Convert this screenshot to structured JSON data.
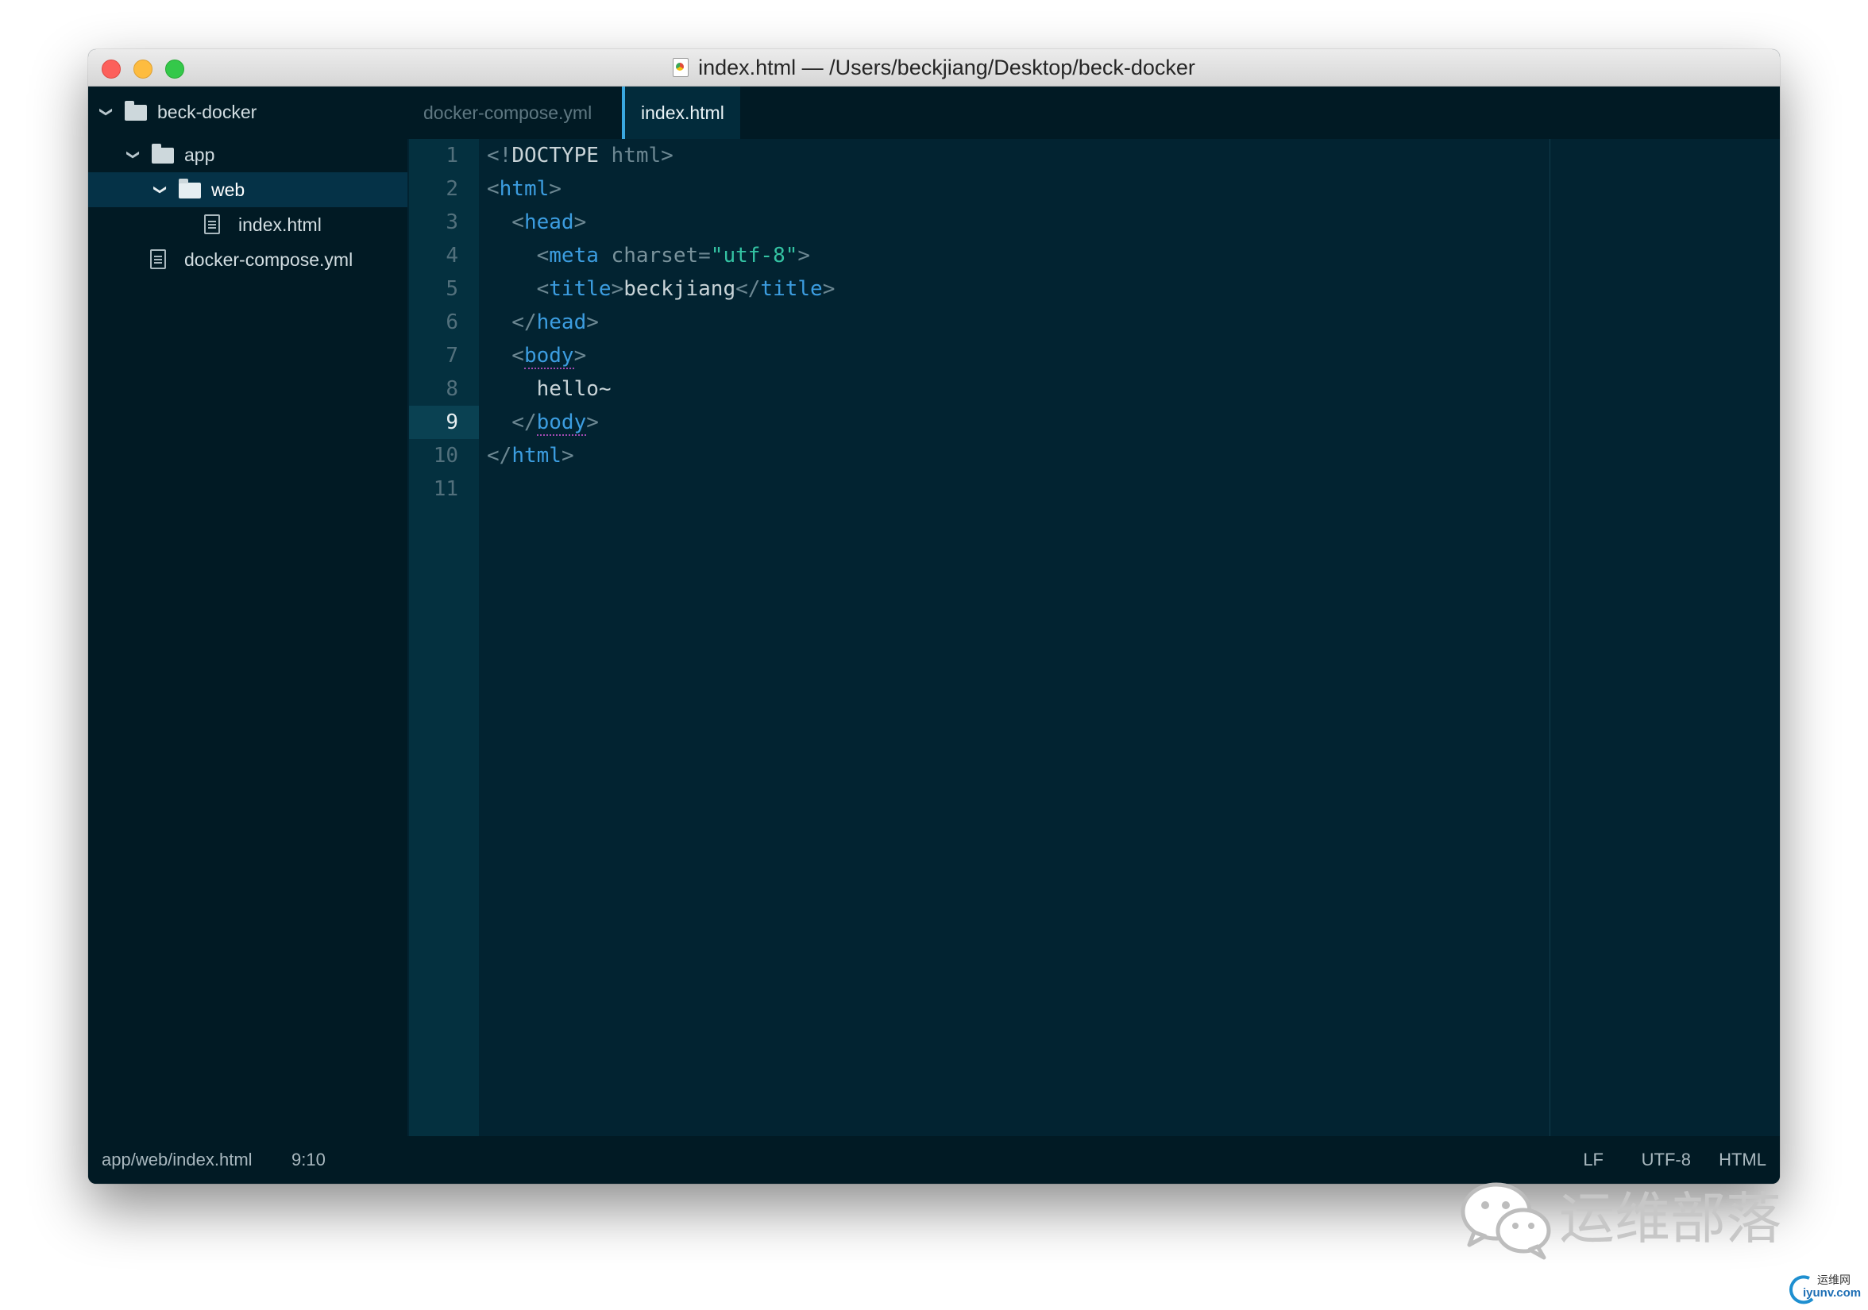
{
  "window": {
    "title": "index.html — /Users/beckjiang/Desktop/beck-docker"
  },
  "sidebar": {
    "project": "beck-docker",
    "items": [
      {
        "label": "app"
      },
      {
        "label": "web"
      },
      {
        "label": "index.html"
      },
      {
        "label": "docker-compose.yml"
      }
    ]
  },
  "tabs": [
    {
      "label": "docker-compose.yml"
    },
    {
      "label": "index.html"
    }
  ],
  "editor": {
    "line_numbers": [
      "1",
      "2",
      "3",
      "4",
      "5",
      "6",
      "7",
      "8",
      "9",
      "10",
      "11"
    ],
    "current_line": "9",
    "lines": [
      [
        {
          "c": "p",
          "t": "<!"
        },
        {
          "c": "x",
          "t": "DOCTYPE"
        },
        {
          "c": "p",
          "t": " html>"
        }
      ],
      [
        {
          "c": "p",
          "t": "<"
        },
        {
          "c": "t",
          "t": "html"
        },
        {
          "c": "p",
          "t": ">"
        }
      ],
      [
        {
          "c": "p",
          "t": "  <"
        },
        {
          "c": "t",
          "t": "head"
        },
        {
          "c": "p",
          "t": ">"
        }
      ],
      [
        {
          "c": "p",
          "t": "    <"
        },
        {
          "c": "t",
          "t": "meta"
        },
        {
          "c": "a",
          "t": " charset"
        },
        {
          "c": "p",
          "t": "="
        },
        {
          "c": "s",
          "t": "\"utf-8\""
        },
        {
          "c": "p",
          "t": ">"
        }
      ],
      [
        {
          "c": "p",
          "t": "    <"
        },
        {
          "c": "t",
          "t": "title"
        },
        {
          "c": "p",
          "t": ">"
        },
        {
          "c": "x",
          "t": "beckjiang"
        },
        {
          "c": "p",
          "t": "</"
        },
        {
          "c": "t",
          "t": "title"
        },
        {
          "c": "p",
          "t": ">"
        }
      ],
      [
        {
          "c": "p",
          "t": "  </"
        },
        {
          "c": "t",
          "t": "head"
        },
        {
          "c": "p",
          "t": ">"
        }
      ],
      [
        {
          "c": "p",
          "t": "  <"
        },
        {
          "c": "t u",
          "t": "body"
        },
        {
          "c": "p",
          "t": ">"
        }
      ],
      [
        {
          "c": "x",
          "t": "    hello~"
        }
      ],
      [
        {
          "c": "p",
          "t": "  </"
        },
        {
          "c": "t u",
          "t": "body"
        },
        {
          "c": "p",
          "t": ">"
        }
      ],
      [
        {
          "c": "p",
          "t": "</"
        },
        {
          "c": "t",
          "t": "html"
        },
        {
          "c": "p",
          "t": ">"
        }
      ],
      []
    ]
  },
  "status": {
    "path": "app/web/index.html",
    "cursor": "9:10",
    "line_ending": "LF",
    "encoding": "UTF-8",
    "grammar": "HTML"
  },
  "watermark": {
    "text": "运维部落",
    "logo_top": "运维网",
    "logo_bottom": "iyunv.com"
  },
  "icons": {
    "folder": "folder-icon",
    "file": "file-icon",
    "chevron": "chevron-down-icon",
    "wechat": "wechat-icon"
  }
}
